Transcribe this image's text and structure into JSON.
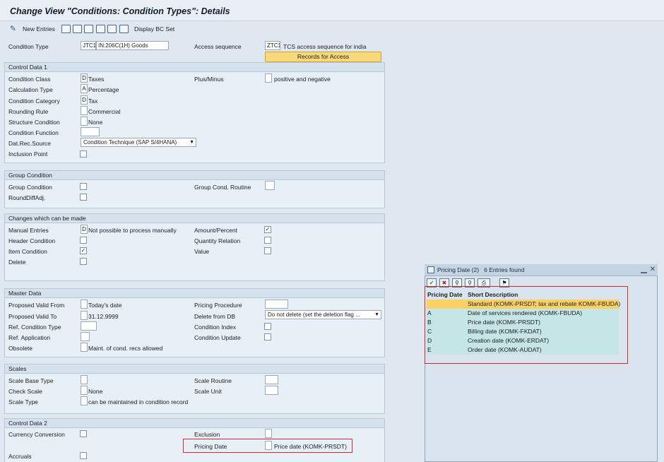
{
  "window": {
    "title": "Change View \"Conditions: Condition Types\": Details"
  },
  "toolbar": {
    "new_entries_label": "New Entries",
    "display_bc_set_label": "Display BC Set",
    "icons": [
      "magic-wand-icon",
      "copy-icon",
      "delete-icon",
      "undo-icon",
      "select-all-icon",
      "deselect-icon",
      "save-icon"
    ]
  },
  "header": {
    "condition_type_label": "Condition Type",
    "condition_type_code": "JTC1",
    "condition_type_desc": "IN:206C(1H) Goods",
    "access_sequence_label": "Access sequence",
    "access_sequence_code": "ZTC1",
    "access_sequence_desc": "TCS access sequence for india",
    "records_button": "Records for Access"
  },
  "control_data_1": {
    "heading": "Control Data 1",
    "condition_class_label": "Condition Class",
    "condition_class_code": "D",
    "condition_class_value": "Taxes",
    "plus_minus_label": "Plus/Minus",
    "plus_minus_value": "positive and negative",
    "calculation_type_label": "Calculation Type",
    "calculation_type_code": "A",
    "calculation_type_value": "Percentage",
    "condition_category_label": "Condition Category",
    "condition_category_code": "D",
    "condition_category_value": "Tax",
    "rounding_rule_label": "Rounding Rule",
    "rounding_rule_value": "Commercial",
    "structure_condition_label": "Structure Condition",
    "structure_condition_value": "None",
    "condition_function_label": "Condition Function",
    "dat_rec_source_label": "Dat.Rec.Source",
    "dat_rec_source_value": "Condition Technique (SAP S/4HANA)",
    "inclusion_point_label": "Inclusion Point"
  },
  "group_condition": {
    "heading": "Group Condition",
    "group_condition_label": "Group Condition",
    "group_cond_routine_label": "Group Cond. Routine",
    "round_diff_label": "RoundDiffAdj."
  },
  "changes": {
    "heading": "Changes which can be made",
    "manual_entries_label": "Manual Entries",
    "manual_entries_code": "D",
    "manual_entries_value": "Not possible to process manually",
    "amount_percent_label": "Amount/Percent",
    "amount_percent_checked": true,
    "header_condition_label": "Header Condition",
    "quantity_relation_label": "Quantity Relation",
    "item_condition_label": "Item Condition",
    "item_condition_checked": true,
    "value_label": "Value",
    "delete_label": "Delete"
  },
  "master_data": {
    "heading": "Master Data",
    "proposed_valid_from_label": "Proposed Valid From",
    "proposed_valid_from_value": "Today's date",
    "pricing_procedure_label": "Pricing Procedure",
    "proposed_valid_to_label": "Proposed Valid To",
    "proposed_valid_to_value": "31.12.9999",
    "delete_from_db_label": "Delete from DB",
    "delete_from_db_value": "Do not delete (set the deletion flag ...",
    "ref_condition_type_label": "Ref. Condition Type",
    "condition_index_label": "Condition Index",
    "ref_application_label": "Ref. Application",
    "condition_update_label": "Condition Update",
    "obsolete_label": "Obsolete",
    "obsolete_value": "Maint. of cond. recs allowed"
  },
  "scales": {
    "heading": "Scales",
    "scale_base_type_label": "Scale Base Type",
    "scale_routine_label": "Scale Routine",
    "check_scale_label": "Check Scale",
    "check_scale_value": "None",
    "scale_unit_label": "Scale Unit",
    "scale_type_label": "Scale Type",
    "scale_type_value": "can be maintained in condition record"
  },
  "control_data_2": {
    "heading": "Control Data 2",
    "currency_conversion_label": "Currency Conversion",
    "exclusion_label": "Exclusion",
    "pricing_date_label": "Pricing Date",
    "pricing_date_value": "Price date (KOMK-PRSDT)",
    "accruals_label": "Accruals"
  },
  "popup": {
    "title": "Pricing Date (2)",
    "entries_found": "6 Entries found",
    "col_code": "Pricing Date",
    "col_desc": "Short Description",
    "rows": [
      {
        "code": "",
        "desc": "Standard (KOMK-PRSDT; tax and rebate KOMK-FBUDA)"
      },
      {
        "code": "A",
        "desc": "Date of services rendered (KOMK-FBUDA)"
      },
      {
        "code": "B",
        "desc": "Price date (KOMK-PRSDT)"
      },
      {
        "code": "C",
        "desc": "Billing date (KOMK-FKDAT)"
      },
      {
        "code": "D",
        "desc": "Creation date (KOMK-ERDAT)"
      },
      {
        "code": "E",
        "desc": "Order date (KOMK-AUDAT)"
      }
    ]
  },
  "colors": {
    "background": "#dfe8f1",
    "section_header": "#d5e1ec",
    "button": "#f7d97a",
    "selected_row": "#fbd166",
    "alt_row": "#c5e5e7",
    "highlight_box": "#d22b2b"
  }
}
